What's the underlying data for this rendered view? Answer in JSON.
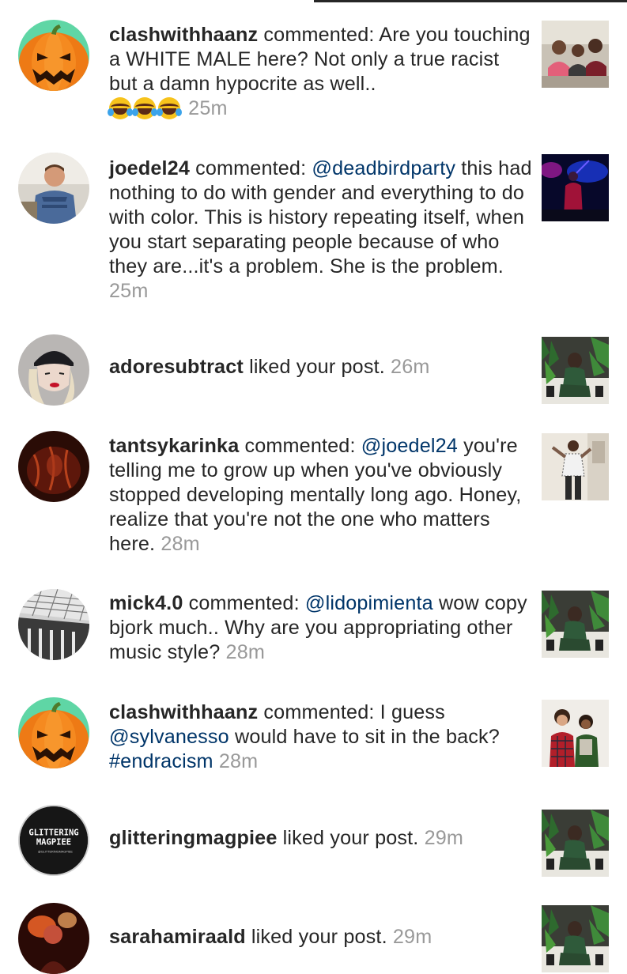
{
  "notifications": [
    {
      "username": "clashwithhaanz",
      "action": " commented: Are you touching a WHITE MALE here? Not only a true racist but a damn hypocrite as well..",
      "emojis": [
        "face-with-tears-of-joy",
        "face-with-tears-of-joy",
        "face-with-tears-of-joy"
      ],
      "time": "25m",
      "avatar": "pumpkin-avatar",
      "thumbnail": "group-photo-thumbnail"
    },
    {
      "username": "joedel24",
      "action_prefix": " commented: ",
      "mention": "@deadbirdparty",
      "action": " this had nothing to do with gender and everything to do with color. This is history repeating itself, when you start separating people because of who they are...it's a problem. She is the problem.",
      "time": "25m",
      "avatar": "man-photo-avatar",
      "thumbnail": "concert-photo-thumbnail"
    },
    {
      "username": "adoresubtract",
      "action": " liked your post.",
      "time": "26m",
      "avatar": "woman-beanie-avatar",
      "thumbnail": "plants-photo-thumbnail"
    },
    {
      "username": "tantsykarinka",
      "action_prefix": " commented: ",
      "mention": "@joedel24",
      "action": " you're telling me to grow up when you've obviously stopped developing mentally long ago. Honey, realize that you're not the one who matters here.",
      "time": "28m",
      "avatar": "dark-red-avatar",
      "thumbnail": "standing-person-thumbnail"
    },
    {
      "username": "mick4.0",
      "action_prefix": " commented: ",
      "mention": "@lidopimienta",
      "action": " wow copy bjork much.. Why are you appropriating other music style?",
      "time": "28m",
      "avatar": "building-avatar",
      "thumbnail": "plants-photo-thumbnail"
    },
    {
      "username": "clashwithhaanz",
      "action_prefix": " commented: I guess ",
      "mention": "@sylvanesso",
      "action": " would have to sit in the back? ",
      "hashtag": "#endracism",
      "time": "28m",
      "avatar": "pumpkin-avatar",
      "thumbnail": "two-people-thumbnail"
    },
    {
      "username": "glitteringmagpiee",
      "action": " liked your post.",
      "time": "29m",
      "avatar": "logo-avatar",
      "avatar_text_1": "GLITTERING",
      "avatar_text_2": "MAGPIEE",
      "avatar_text_3": "@GLITTERINGMAGPIEE",
      "thumbnail": "plants-photo-thumbnail"
    },
    {
      "username": "sarahamiraald",
      "action": " liked your post.",
      "time": "29m",
      "avatar": "concert-avatar",
      "thumbnail": "plants-photo-thumbnail"
    }
  ],
  "colors": {
    "text": "#262626",
    "mention": "#003569",
    "timestamp": "#999999",
    "pumpkin": "#f07a12",
    "pumpkin_bg": "#5fd6a5"
  }
}
